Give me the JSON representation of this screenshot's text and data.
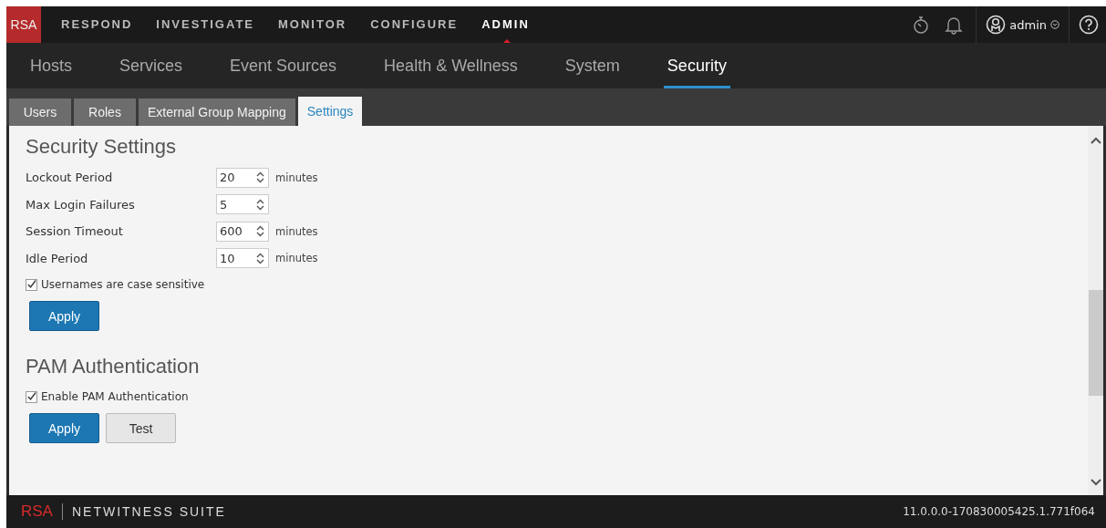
{
  "top_nav": {
    "logo": "RSA",
    "items": [
      {
        "label": "RESPOND",
        "selected": false
      },
      {
        "label": "INVESTIGATE",
        "selected": false
      },
      {
        "label": "MONITOR",
        "selected": false
      },
      {
        "label": "CONFIGURE",
        "selected": false
      },
      {
        "label": "ADMIN",
        "selected": true
      }
    ],
    "user": "admin"
  },
  "sub_nav": [
    {
      "label": "Hosts",
      "selected": false
    },
    {
      "label": "Services",
      "selected": false
    },
    {
      "label": "Event Sources",
      "selected": false
    },
    {
      "label": "Health & Wellness",
      "selected": false
    },
    {
      "label": "System",
      "selected": false
    },
    {
      "label": "Security",
      "selected": true
    }
  ],
  "tabs": [
    {
      "label": "Users",
      "selected": false
    },
    {
      "label": "Roles",
      "selected": false
    },
    {
      "label": "External Group Mapping",
      "selected": false
    },
    {
      "label": "Settings",
      "selected": true
    }
  ],
  "sections": [
    {
      "title": "Security Settings",
      "fields": [
        {
          "label": "Lockout Period",
          "value": "20",
          "unit": "minutes"
        },
        {
          "label": "Max Login Failures",
          "value": "5"
        },
        {
          "label": "Session Timeout",
          "value": "600",
          "unit": "minutes"
        },
        {
          "label": "Idle Period",
          "value": "10",
          "unit": "minutes"
        }
      ],
      "checkbox": {
        "label": "Usernames are case sensitive",
        "checked": true
      },
      "buttons": [
        {
          "label": "Apply",
          "kind": "primary"
        }
      ]
    },
    {
      "title": "PAM Authentication",
      "checkbox": {
        "label": "Enable PAM Authentication",
        "checked": true
      },
      "buttons": [
        {
          "label": "Apply",
          "kind": "primary"
        },
        {
          "label": "Test",
          "kind": "secondary"
        }
      ]
    }
  ],
  "footer": {
    "logo": "RSA",
    "product": "NETWITNESS SUITE",
    "version": "11.0.0.0-170830005425.1.771f064"
  }
}
